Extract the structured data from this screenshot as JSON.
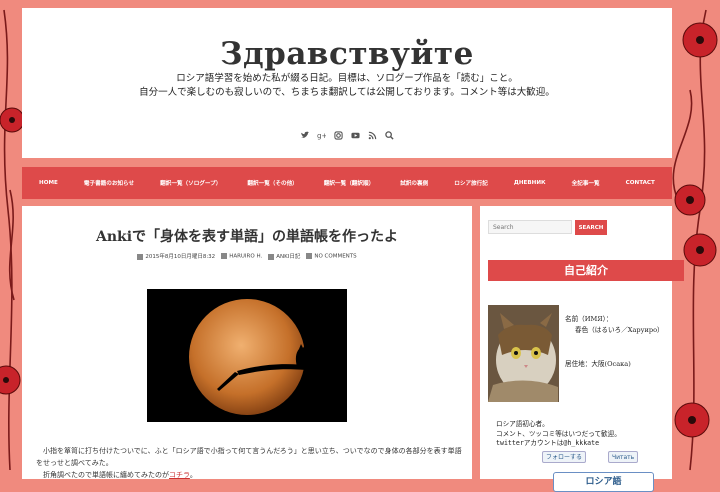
{
  "header": {
    "title": "Здравствуйте",
    "description_line1": "ロシア語学習を始めた私が綴る日記。目標は、ソログープ作品を「読む」こと。",
    "description_line2": "自分一人で楽しむのも寂しいので、ちまちま翻訳しては公開しております。コメント等は大歓迎。",
    "social_icons": [
      "twitter-icon",
      "google-plus-icon",
      "instagram-icon",
      "youtube-icon",
      "rss-icon",
      "search-icon"
    ]
  },
  "nav": {
    "items": [
      {
        "label": "HOME"
      },
      {
        "label": "電子書籍のお知らせ"
      },
      {
        "label": "翻訳一覧（ソログープ）"
      },
      {
        "label": "翻訳一覧（その他）"
      },
      {
        "label": "翻訳一覧（翻訳順）"
      },
      {
        "label": "試訳の裏側"
      },
      {
        "label": "ロシア旅行記"
      },
      {
        "label": "ДНЕВНИК"
      },
      {
        "label": "全記事一覧"
      },
      {
        "label": "CONTACT"
      }
    ],
    "colors": {
      "bar": "#de4a4a",
      "text": "#ffffff"
    }
  },
  "post": {
    "title": "Ankiで「身体を表す単語」の単語帳を作ったよ",
    "date": "2015年8月10日月曜日8:32",
    "author": "HARUIRO H.",
    "category": "ANKI日記",
    "comments": "NO COMMENTS",
    "body_line1": "小指を箪笥に打ち付けたついでに、ふと「ロシア語で小指って何て言うんだろう」と思い立ち、ついでなので身体の各部分を表す単語をせっせと調べてみた。",
    "body_line2_prefix": "折角調べたので単語帳に纏めてみたのが",
    "body_link": "コチラ",
    "body_line2_suffix": "。"
  },
  "sidebar": {
    "search_placeholder": "Search",
    "search_button": "SEARCH",
    "widget_title": "自己紹介",
    "profile_name_label": "名前（ИМЯ）：",
    "profile_name_value": "春色（はるいろ／Харуиро）",
    "profile_location": "居住地：大阪(Осака)",
    "note_line1": "ロシア語初心者。",
    "note_line2": "コメント、ツッコミ等はいつだって歓迎。",
    "note_line3": "twitterアカウントは@h_kkkate",
    "follow_button": "フォローする",
    "read_button": "Читать",
    "russian_button": "ロシア語"
  }
}
